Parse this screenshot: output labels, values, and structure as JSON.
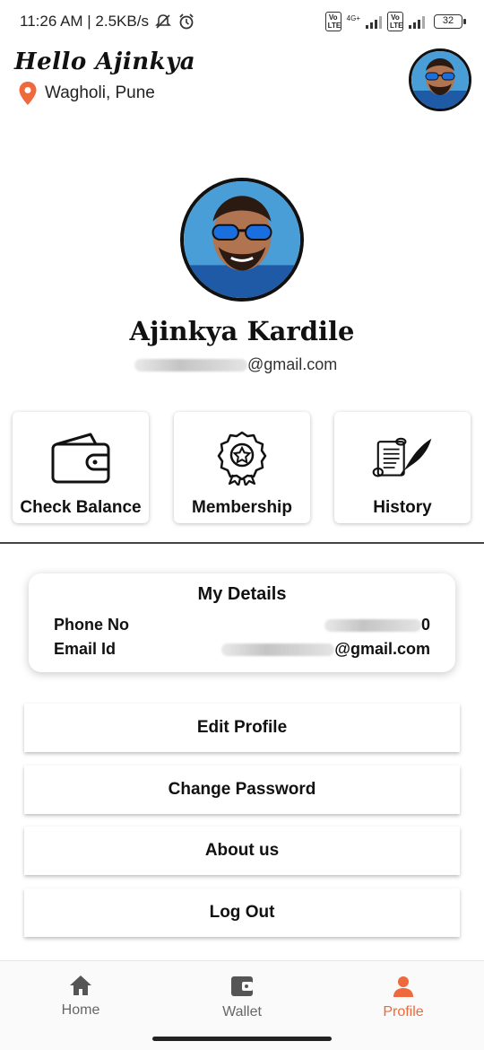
{
  "status_bar": {
    "time_info": "11:26 AM | 2.5KB/s",
    "network_label": "4G+",
    "volte_1": "Vo LTE",
    "volte_2": "Vo LTE",
    "battery": "32"
  },
  "header": {
    "greeting": "Hello Ajinkya",
    "location": "Wagholi, Pune"
  },
  "profile": {
    "name": "Ajinkya Kardile",
    "email_suffix": "@gmail.com"
  },
  "actions": [
    {
      "label": "Check Balance",
      "icon": "wallet-icon"
    },
    {
      "label": "Membership",
      "icon": "badge-icon"
    },
    {
      "label": "History",
      "icon": "scroll-quill-icon"
    }
  ],
  "details": {
    "title": "My Details",
    "phone_label": "Phone No",
    "phone_suffix": "0",
    "email_label": "Email Id",
    "email_suffix": "@gmail.com"
  },
  "buttons": {
    "edit_profile": "Edit Profile",
    "change_password": "Change Password",
    "about_us": "About us",
    "log_out": "Log Out"
  },
  "nav": {
    "home": "Home",
    "wallet": "Wallet",
    "profile": "Profile",
    "active": "Profile"
  },
  "colors": {
    "accent": "#ee6a3d",
    "text": "#111111"
  }
}
